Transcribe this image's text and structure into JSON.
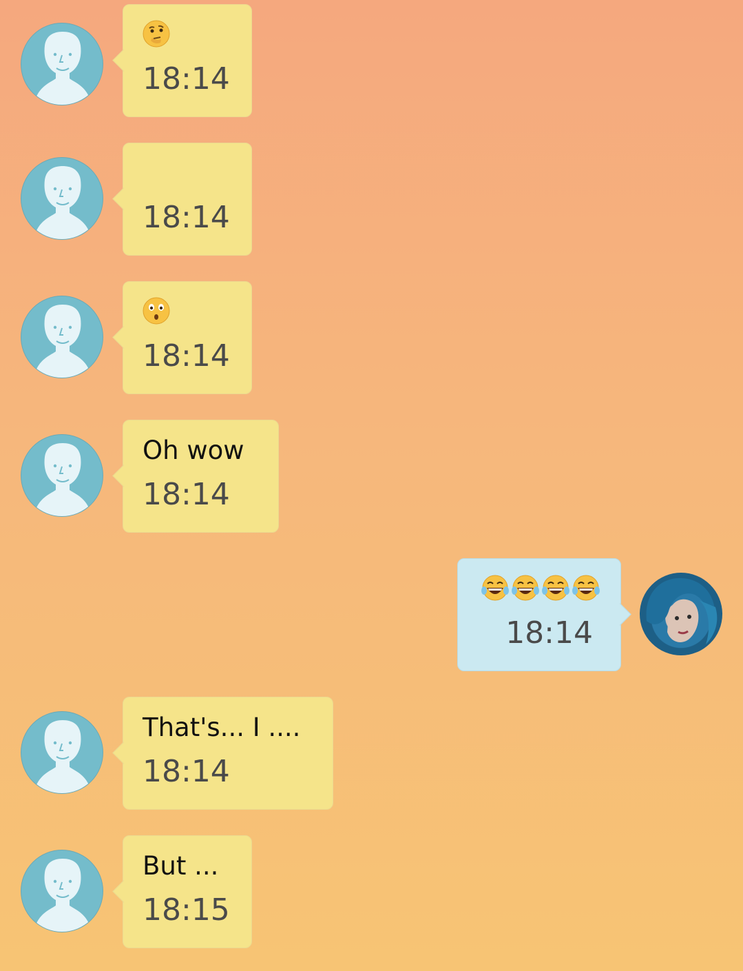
{
  "messages": [
    {
      "direction": "in",
      "text": "",
      "emoji": [
        "thinking-face"
      ],
      "time": "18:14"
    },
    {
      "direction": "in",
      "text": "",
      "emoji": [],
      "time": "18:14"
    },
    {
      "direction": "in",
      "text": "",
      "emoji": [
        "hushed-face"
      ],
      "time": "18:14"
    },
    {
      "direction": "in",
      "text": "Oh wow",
      "emoji": [],
      "time": "18:14"
    },
    {
      "direction": "out",
      "text": "",
      "emoji": [
        "tears-of-joy-face",
        "tears-of-joy-face",
        "tears-of-joy-face",
        "tears-of-joy-face"
      ],
      "time": "18:14"
    },
    {
      "direction": "in",
      "text": "That's... I ....",
      "emoji": [],
      "time": "18:14"
    },
    {
      "direction": "in",
      "text": "But ...",
      "emoji": [],
      "time": "18:15"
    }
  ],
  "colors": {
    "incoming_bubble": "#f5e48a",
    "outgoing_bubble": "#cbe9f1",
    "avatar_placeholder": "#74bccb",
    "background_top": "#f5a87e",
    "background_bottom": "#f7c474"
  }
}
